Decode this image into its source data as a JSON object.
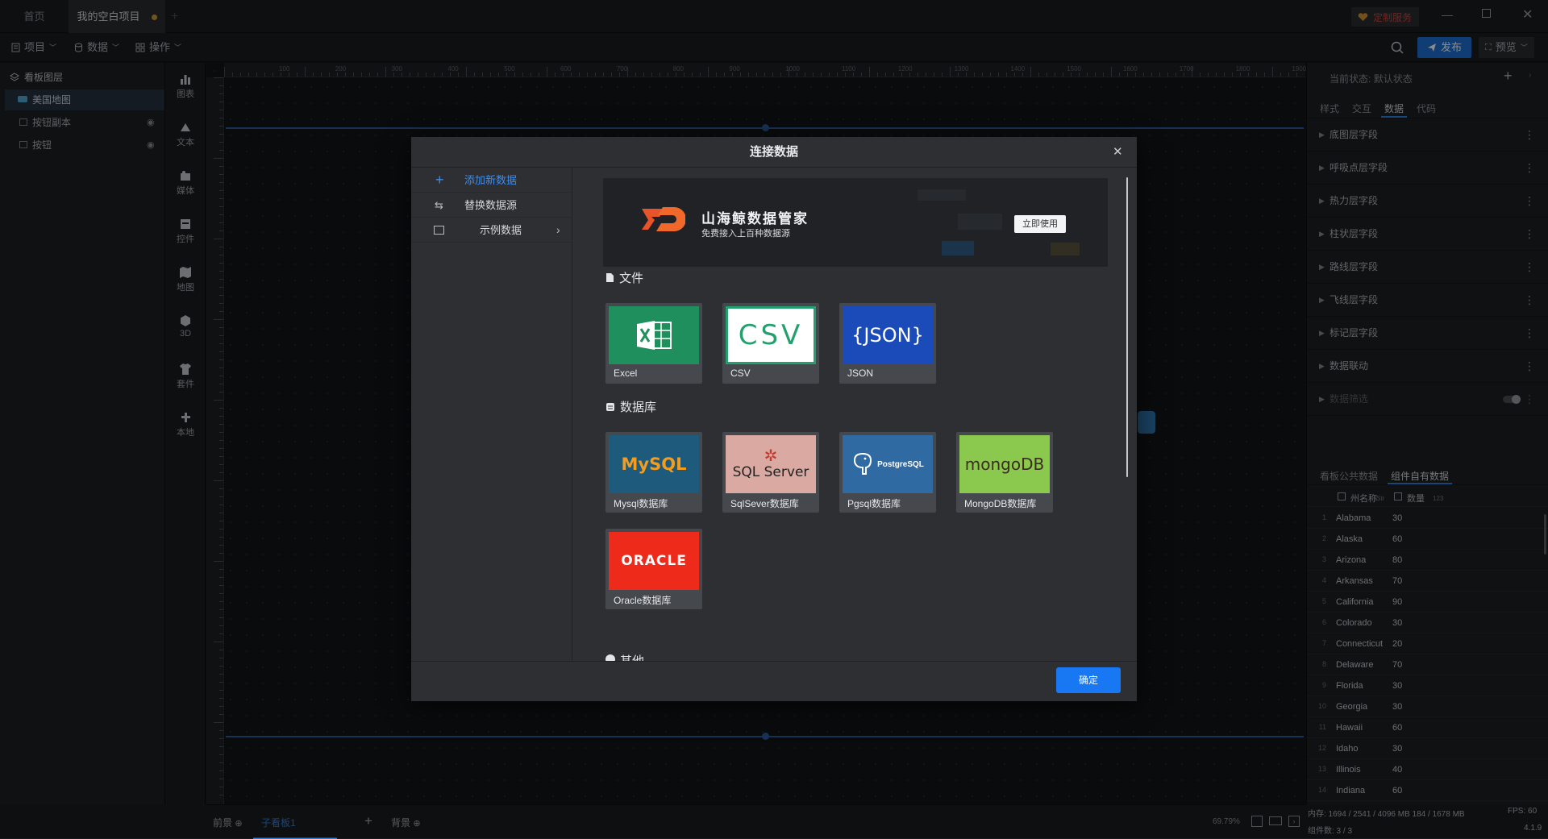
{
  "tabs": {
    "home": "首页",
    "project": "我的空白项目"
  },
  "window": {
    "custom_service": "定制服务"
  },
  "toolbar": {
    "project": "项目",
    "data": "数据",
    "operate": "操作",
    "publish": "发布",
    "preview": "预览"
  },
  "layers": {
    "header": "看板图层",
    "items": [
      {
        "label": "美国地图"
      },
      {
        "label": "按钮副本"
      },
      {
        "label": "按钮"
      }
    ]
  },
  "rail": [
    "图表",
    "文本",
    "媒体",
    "控件",
    "地图",
    "3D",
    "套件",
    "本地"
  ],
  "ruler": {
    "h": [
      "100",
      "200",
      "300",
      "400",
      "500",
      "600",
      "700",
      "800",
      "900",
      "1000",
      "1100",
      "1200",
      "1300",
      "1400",
      "1500",
      "1600",
      "1700",
      "1800",
      "1900"
    ]
  },
  "right": {
    "state_label": "当前状态:",
    "state_value": "默认状态",
    "tabs": [
      "样式",
      "交互",
      "数据",
      "代码"
    ],
    "sections": [
      "底图层字段",
      "呼吸点层字段",
      "热力层字段",
      "柱状层字段",
      "路线层字段",
      "飞线层字段",
      "标记层字段",
      "数据联动",
      "数据筛选"
    ],
    "data_tabs": [
      "看板公共数据",
      "组件自有数据"
    ],
    "columns": [
      {
        "name": "州名称",
        "type": "Str"
      },
      {
        "name": "数量",
        "type": "123"
      }
    ],
    "rows": [
      [
        "Alabama",
        "30"
      ],
      [
        "Alaska",
        "60"
      ],
      [
        "Arizona",
        "80"
      ],
      [
        "Arkansas",
        "70"
      ],
      [
        "California",
        "90"
      ],
      [
        "Colorado",
        "30"
      ],
      [
        "Connecticut",
        "20"
      ],
      [
        "Delaware",
        "70"
      ],
      [
        "Florida",
        "30"
      ],
      [
        "Georgia",
        "30"
      ],
      [
        "Hawaii",
        "60"
      ],
      [
        "Idaho",
        "30"
      ],
      [
        "Illinois",
        "40"
      ],
      [
        "Indiana",
        "60"
      ]
    ]
  },
  "bottom": {
    "foreground": "前景",
    "sub_board": "子看板1",
    "background": "背景",
    "zoom": "69.79%",
    "memory": "内存: 1694 / 2541 / 4096 MB  184 / 1678 MB",
    "fps": "FPS: 60",
    "components": "组件数: 3 / 3",
    "version": "4.1.9"
  },
  "modal": {
    "title": "连接数据",
    "side": [
      "添加新数据",
      "替换数据源",
      "示例数据"
    ],
    "banner": {
      "title": "山海鲸数据管家",
      "subtitle": "免费接入上百种数据源",
      "button": "立即使用"
    },
    "file_section": "文件",
    "files": [
      {
        "label": "Excel"
      },
      {
        "label": "CSV"
      },
      {
        "label": "JSON"
      }
    ],
    "db_section": "数据库",
    "dbs": [
      {
        "label": "Mysql数据库"
      },
      {
        "label": "SqlSever数据库"
      },
      {
        "label": "Pgsql数据库"
      },
      {
        "label": "MongoDB数据库"
      },
      {
        "label": "Oracle数据库"
      }
    ],
    "other_section": "其他",
    "confirm": "确定",
    "logos": {
      "csv": "CSV",
      "json": "{JSON}",
      "mysql": "MySQL",
      "sqlserver": "SQL Server",
      "postgres": "PostgreSQL",
      "mongo": "mongoDB",
      "oracle": "ORACLE"
    }
  }
}
